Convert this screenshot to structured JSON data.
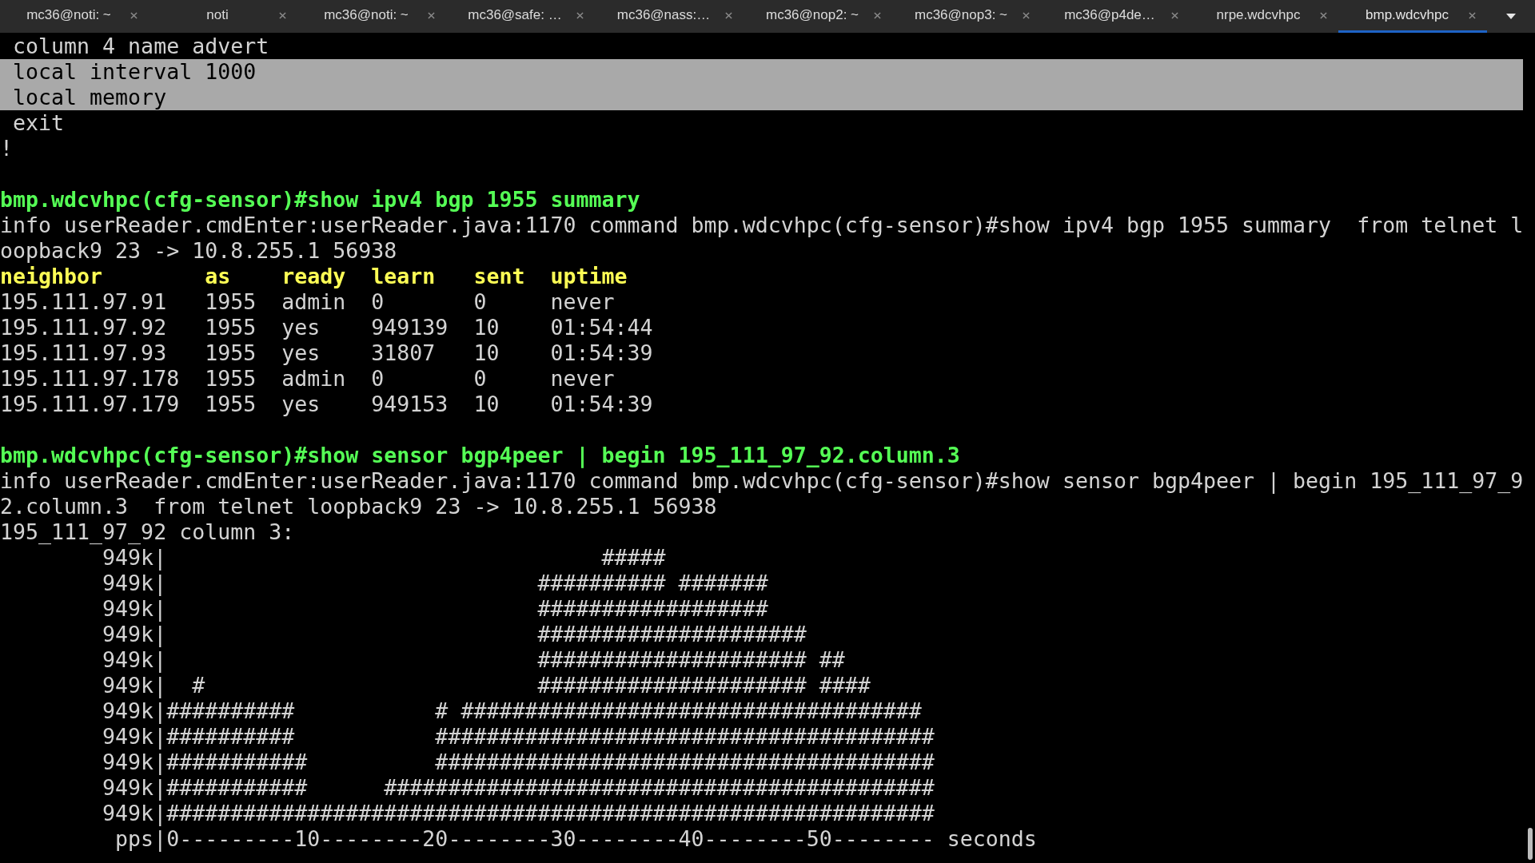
{
  "tabs": [
    {
      "label": "mc36@noti: ~",
      "selected": false
    },
    {
      "label": "noti",
      "selected": false
    },
    {
      "label": "mc36@noti: ~",
      "selected": false
    },
    {
      "label": "mc36@safe: …",
      "selected": false
    },
    {
      "label": "mc36@nass:…",
      "selected": false
    },
    {
      "label": "mc36@nop2: ~",
      "selected": false
    },
    {
      "label": "mc36@nop3: ~",
      "selected": false
    },
    {
      "label": "mc36@p4de…",
      "selected": false
    },
    {
      "label": "nrpe.wdcvhpc",
      "selected": false
    },
    {
      "label": "bmp.wdcvhpc",
      "selected": true
    }
  ],
  "terminal": {
    "lines": [
      {
        "kind": "output",
        "text": " column 4 name advert",
        "selected": false
      },
      {
        "kind": "output",
        "text": " local interval 1000",
        "selected": true
      },
      {
        "kind": "output",
        "text": " local memory",
        "selected": true
      },
      {
        "kind": "output",
        "text": " exit",
        "selected": false
      },
      {
        "kind": "output",
        "text": "!",
        "selected": false
      },
      {
        "kind": "blank",
        "selected": false
      },
      {
        "kind": "prompt",
        "text": "bmp.wdcvhpc(cfg-sensor)#show ipv4 bgp 1955 summary",
        "selected": false
      },
      {
        "kind": "output",
        "text": "info userReader.cmdEnter:userReader.java:1170 command bmp.wdcvhpc(cfg-sensor)#show ipv4 bgp 1955 summary  from telnet l",
        "selected": false
      },
      {
        "kind": "output",
        "text": "oopback9 23 -> 10.8.255.1 56938",
        "selected": false
      },
      {
        "kind": "header",
        "text": "neighbor        as    ready  learn   sent  uptime",
        "selected": false
      },
      {
        "kind": "output",
        "text": "195.111.97.91   1955  admin  0       0     never",
        "selected": false
      },
      {
        "kind": "output",
        "text": "195.111.97.92   1955  yes    949139  10    01:54:44",
        "selected": false
      },
      {
        "kind": "output",
        "text": "195.111.97.93   1955  yes    31807   10    01:54:39",
        "selected": false
      },
      {
        "kind": "output",
        "text": "195.111.97.178  1955  admin  0       0     never",
        "selected": false
      },
      {
        "kind": "output",
        "text": "195.111.97.179  1955  yes    949153  10    01:54:39",
        "selected": false
      },
      {
        "kind": "blank",
        "selected": false
      },
      {
        "kind": "prompt",
        "text": "bmp.wdcvhpc(cfg-sensor)#show sensor bgp4peer | begin 195_111_97_92.column.3",
        "selected": false
      },
      {
        "kind": "output",
        "text": "info userReader.cmdEnter:userReader.java:1170 command bmp.wdcvhpc(cfg-sensor)#show sensor bgp4peer | begin 195_111_97_9",
        "selected": false
      },
      {
        "kind": "output",
        "text": "2.column.3  from telnet loopback9 23 -> 10.8.255.1 56938",
        "selected": false
      },
      {
        "kind": "output",
        "text": "195_111_97_92 column 3:",
        "selected": false
      },
      {
        "kind": "output",
        "text": "        949k|                                  #####",
        "selected": false
      },
      {
        "kind": "output",
        "text": "        949k|                             ########## #######",
        "selected": false
      },
      {
        "kind": "output",
        "text": "        949k|                             ##################",
        "selected": false
      },
      {
        "kind": "output",
        "text": "        949k|                             #####################",
        "selected": false
      },
      {
        "kind": "output",
        "text": "        949k|                             ##################### ##",
        "selected": false
      },
      {
        "kind": "output",
        "text": "        949k|  #                          ##################### ####",
        "selected": false
      },
      {
        "kind": "output",
        "text": "        949k|##########           # ####################################",
        "selected": false
      },
      {
        "kind": "output",
        "text": "        949k|##########           #######################################",
        "selected": false
      },
      {
        "kind": "output",
        "text": "        949k|###########          #######################################",
        "selected": false
      },
      {
        "kind": "output",
        "text": "        949k|###########      ###########################################",
        "selected": false
      },
      {
        "kind": "output",
        "text": "        949k|############################################################",
        "selected": false
      },
      {
        "kind": "output",
        "text": "         pps|0---------10--------20--------30--------40--------50-------- seconds",
        "selected": false
      }
    ]
  }
}
